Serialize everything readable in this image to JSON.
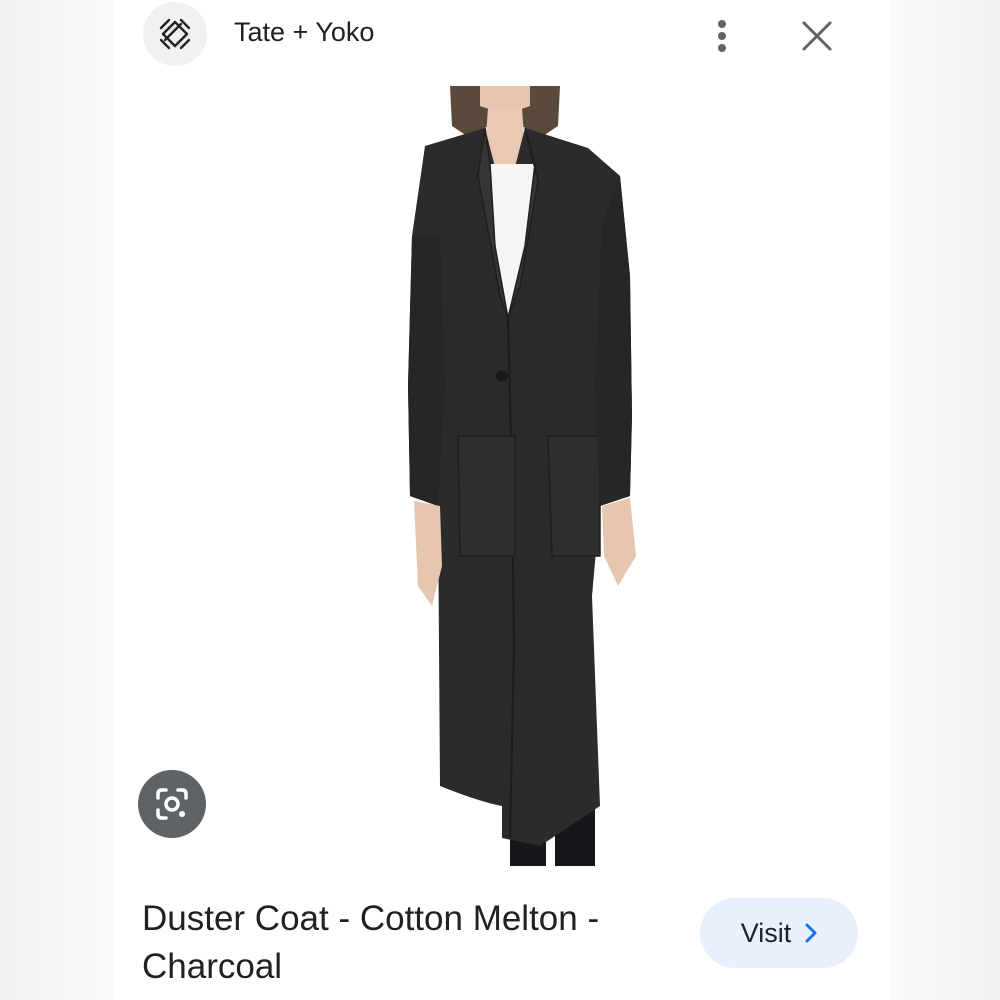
{
  "header": {
    "site_name": "Tate + Yoko",
    "logo_icon": "tate-yoko-logo-icon",
    "more_icon": "more-vert-icon",
    "close_icon": "close-icon"
  },
  "image": {
    "subject": "model wearing charcoal duster coat",
    "lens_icon": "google-lens-icon"
  },
  "product": {
    "title": "Duster Coat - Cotton Melton - Charcoal"
  },
  "actions": {
    "visit_label": "Visit",
    "visit_icon": "chevron-right-icon"
  },
  "colors": {
    "accent": "#1a73e8",
    "visit_bg": "#e8f0fe",
    "coat": "#2b2b2b",
    "lens_bg": "#5f6368"
  }
}
